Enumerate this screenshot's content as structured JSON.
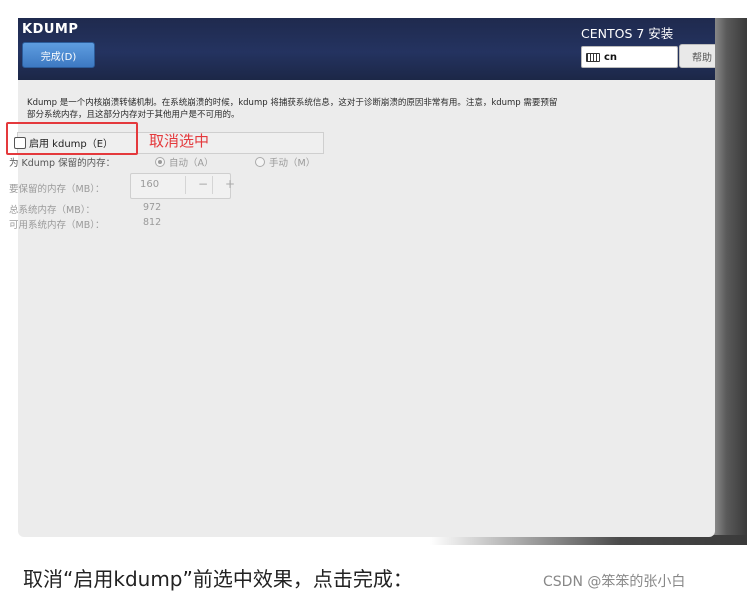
{
  "header": {
    "title": "KDUMP",
    "done_button": "完成(D)",
    "os_title": "CENTOS 7 安装",
    "keyboard_layout": "cn",
    "help_button": "帮助"
  },
  "description": {
    "line1": "Kdump 是一个内核崩溃转储机制。在系统崩溃的时候，kdump 将捕获系统信息，这对于诊断崩溃的原因非常有用。注意，kdump 需要预留",
    "line2": "部分系统内存，且这部分内存对于其他用户是不可用的。"
  },
  "enable": {
    "label": "启用 kdump（E）",
    "checked": false,
    "annotation": "取消选中"
  },
  "reserve": {
    "label": "为 Kdump 保留的内存：",
    "options": [
      {
        "label": "自动（A）",
        "selected": true
      },
      {
        "label": "手动（M）",
        "selected": false
      }
    ]
  },
  "memory": {
    "reserved_label": "要保留的内存（MB）：",
    "reserved_value": "160",
    "decrement": "−",
    "increment": "+",
    "total_label": "总系统内存（MB）：",
    "total_value": "972",
    "usable_label": "可用系统内存（MB）：",
    "usable_value": "812"
  },
  "caption": "取消“启用kdump”前选中效果，点击完成：",
  "watermark": "CSDN @笨笨的张小白",
  "colors": {
    "header_bg": "#243360",
    "done_button": "#4a8ad2",
    "annotation_red": "#e4393c"
  }
}
